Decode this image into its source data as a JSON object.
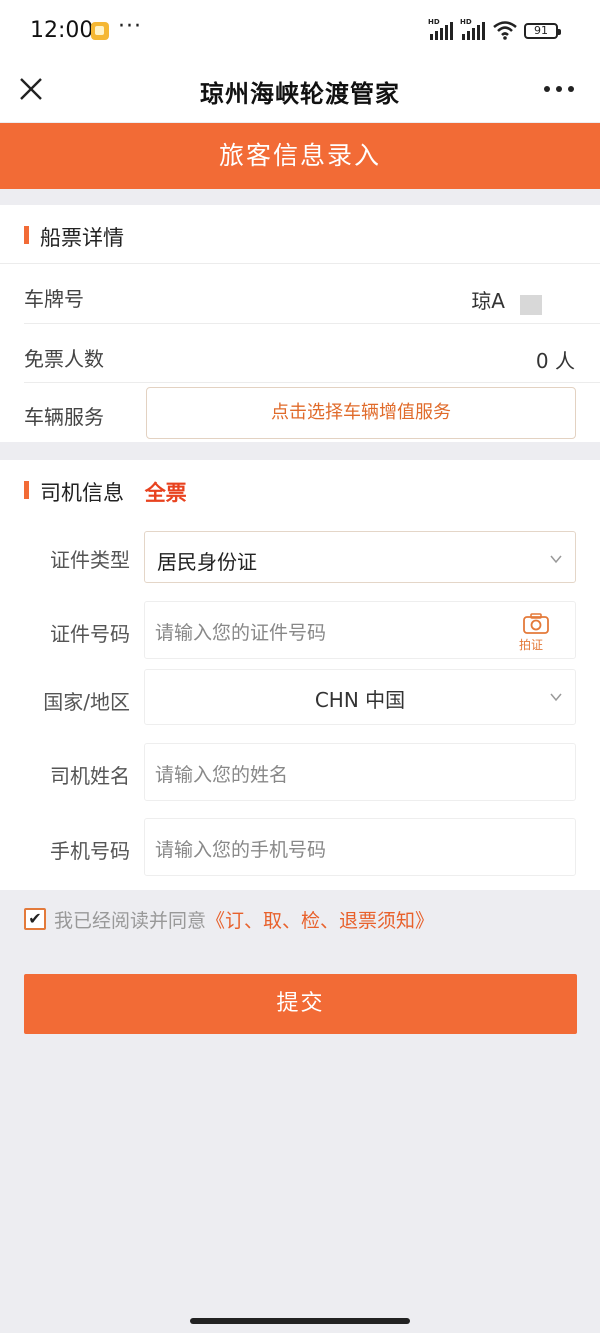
{
  "status_bar": {
    "time": "12:00",
    "dots": "···",
    "battery": "91",
    "hd": "HD"
  },
  "header": {
    "title": "琼州海峡轮渡管家"
  },
  "banner": {
    "text": "旅客信息录入"
  },
  "ticket_section": {
    "title": "船票详情",
    "plate_label": "车牌号",
    "plate_value": "琼A",
    "free_label": "免票人数",
    "free_value": "0 人",
    "service_label": "车辆服务",
    "service_button": "点击选择车辆增值服务"
  },
  "driver_section": {
    "title": "司机信息",
    "tag": "全票",
    "id_type_label": "证件类型",
    "id_type_value": "居民身份证",
    "id_number_label": "证件号码",
    "id_number_placeholder": "请输入您的证件号码",
    "camera_label": "拍证",
    "country_label": "国家/地区",
    "country_value": "CHN 中国",
    "name_label": "司机姓名",
    "name_placeholder": "请输入您的姓名",
    "phone_label": "手机号码",
    "phone_placeholder": "请输入您的手机号码"
  },
  "agreement": {
    "text": "我已经阅读并同意",
    "link": "《订、取、检、退票须知》",
    "checked": true
  },
  "submit": {
    "label": "提交"
  },
  "colors": {
    "accent": "#f26b36",
    "tag_red": "#e8421f"
  }
}
